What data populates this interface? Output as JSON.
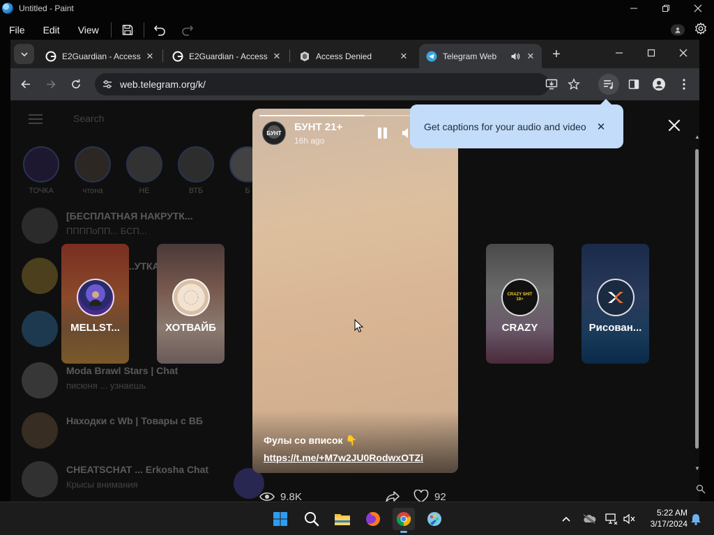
{
  "paint": {
    "window_title": "Untitled - Paint",
    "menu": {
      "file": "File",
      "edit": "Edit",
      "view": "View"
    }
  },
  "browser": {
    "tabs": [
      {
        "label": "E2Guardian - Access",
        "favicon": "google-icon",
        "active": false
      },
      {
        "label": "E2Guardian - Access",
        "favicon": "google-icon",
        "active": false
      },
      {
        "label": "Access Denied",
        "favicon": "access-denied-icon",
        "active": false
      },
      {
        "label": "Telegram Web",
        "favicon": "telegram-icon",
        "active": true,
        "audio": true
      }
    ],
    "url": "web.telegram.org/k/"
  },
  "telegram_bg": {
    "search_placeholder": "Search",
    "stories": [
      {
        "name": "ТОЧКА"
      },
      {
        "name": "чтона"
      },
      {
        "name": "НЕ"
      },
      {
        "name": "ВТБ"
      },
      {
        "name": "Б"
      }
    ],
    "chats": [
      {
        "title": "[БЕСПЛАТНАЯ НАКРУТК...",
        "sub": "ППППоПП... БСП..."
      },
      {
        "title": "...УТКА",
        "sub": ""
      },
      {
        "title": "",
        "sub": ""
      },
      {
        "title": "Moda Brawl Stars | Chat",
        "sub": "писюня ... узнаешь"
      },
      {
        "title": "Находки с Wb | Товары с ВБ",
        "sub": ""
      },
      {
        "title": "CHEATSCHAT ... Erkosha Chat",
        "sub": "Крысы внимания"
      }
    ]
  },
  "stories_viewer": {
    "side_stories": [
      {
        "name": "MELLST...",
        "avatar": "mellstroy-avatar"
      },
      {
        "name": "ХОТВАЙБ",
        "avatar": "hotvibe-avatar"
      },
      {
        "name": "CRAZY",
        "avatar": "crazy-avatar",
        "avatar_text": "CRAZY SHIT 18+"
      },
      {
        "name": "Рисован...",
        "avatar": "risovan-avatar"
      }
    ],
    "current": {
      "author": "БУНТ 21+",
      "avatar_text": "БУНТ",
      "time": "16h ago",
      "caption": "Фулы со вписок 👇",
      "link": "https://t.me/+M7w2JU0RodwxOTZi",
      "views": "9.8K",
      "likes": "92",
      "progress": 0.55
    }
  },
  "captions_popup": {
    "text": "Get captions for your audio and video"
  },
  "taskbar": {
    "time": "5:22 AM",
    "date": "3/17/2024"
  },
  "colors": {
    "popup_bg": "#c3dcf9",
    "accent": "#5a7fd6"
  }
}
